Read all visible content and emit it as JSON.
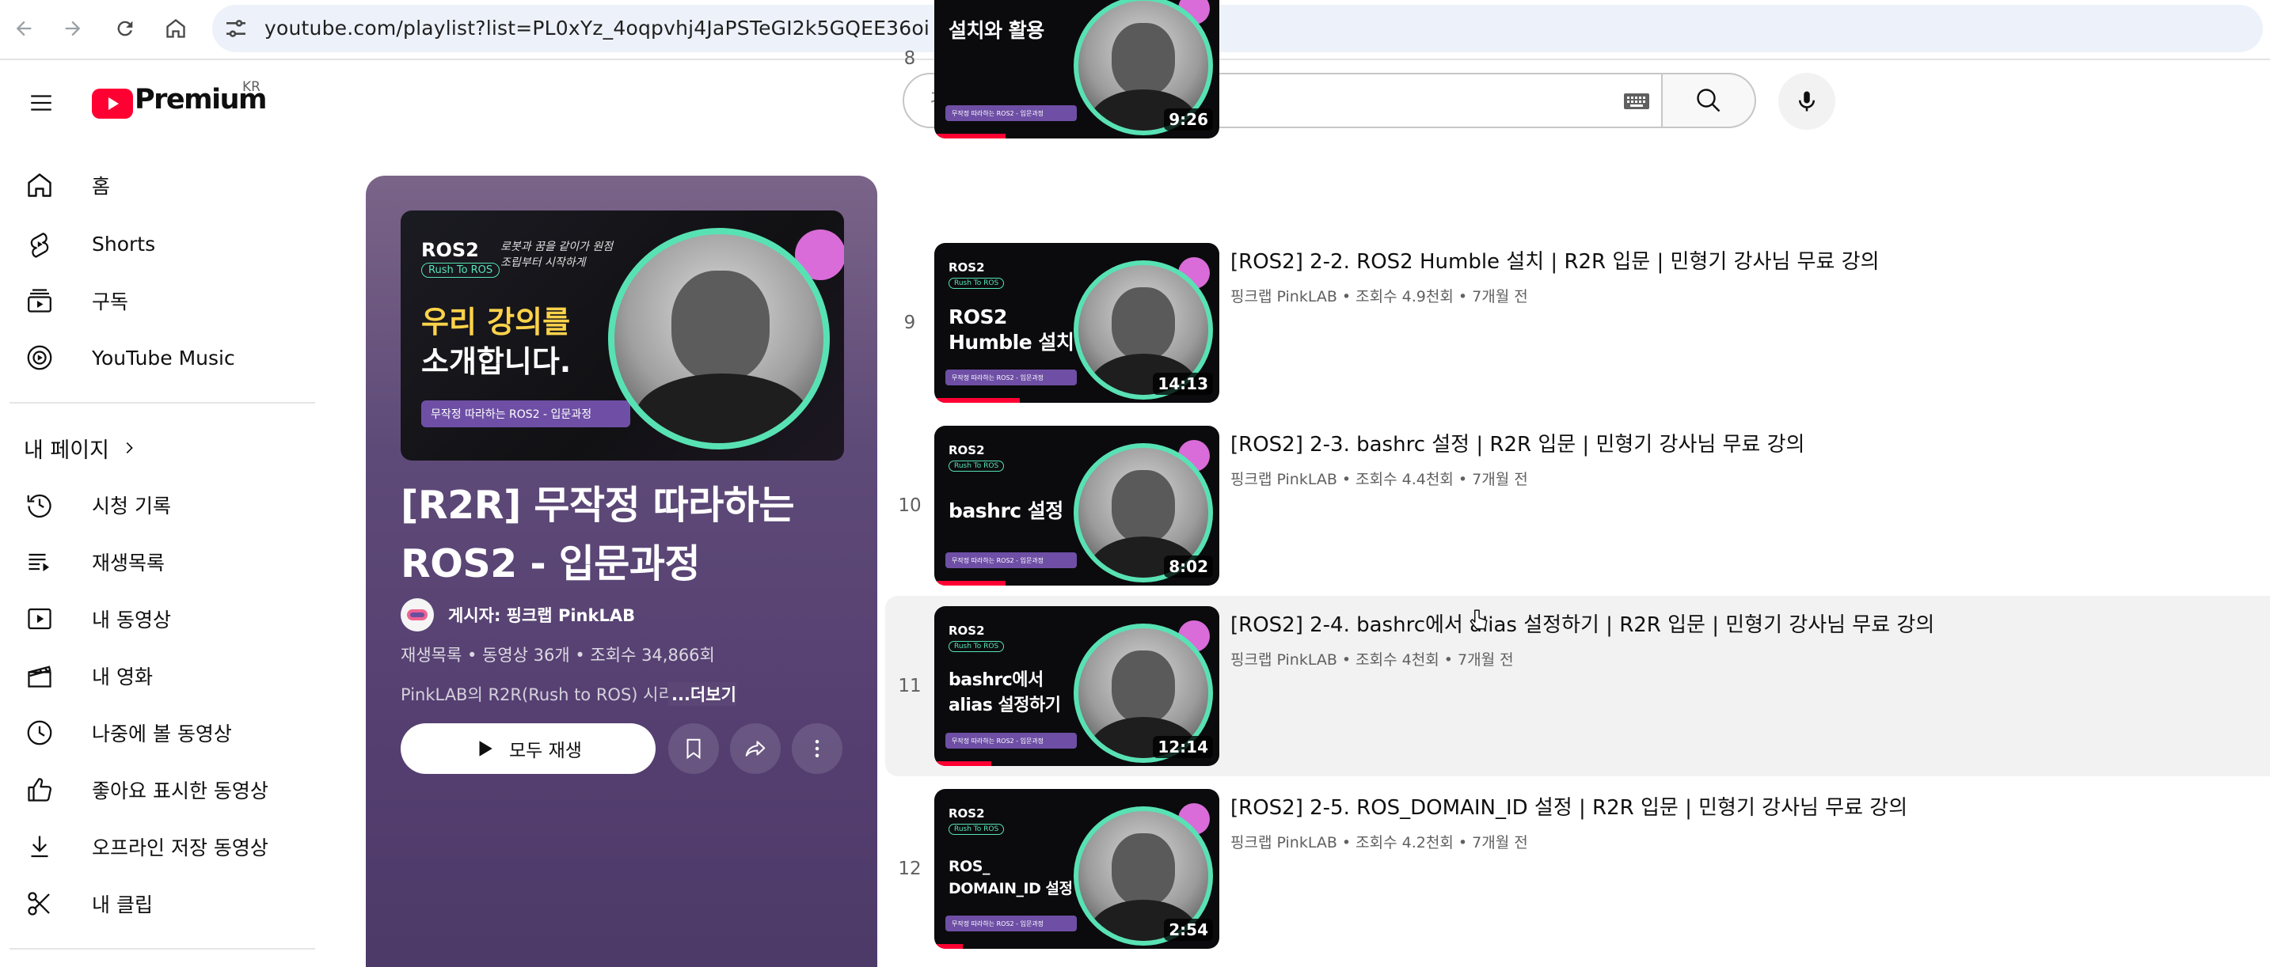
{
  "browser": {
    "url": "youtube.com/playlist?list=PL0xYz_4oqpvhj4JaPSTeGI2k5GQEE36oi"
  },
  "header": {
    "logo_text": "Premium",
    "region": "KR",
    "search_placeholder": "검색"
  },
  "sidebar": {
    "main": [
      {
        "label": "홈",
        "icon": "home-icon"
      },
      {
        "label": "Shorts",
        "icon": "shorts-icon"
      },
      {
        "label": "구독",
        "icon": "subscriptions-icon"
      },
      {
        "label": "YouTube Music",
        "icon": "youtube-music-icon"
      }
    ],
    "section_title": "내 페이지",
    "you": [
      {
        "label": "시청 기록",
        "icon": "history-icon"
      },
      {
        "label": "재생목록",
        "icon": "playlists-icon"
      },
      {
        "label": "내 동영상",
        "icon": "your-videos-icon"
      },
      {
        "label": "내 영화",
        "icon": "your-movies-icon"
      },
      {
        "label": "나중에 볼 동영상",
        "icon": "watch-later-icon"
      },
      {
        "label": "좋아요 표시한 동영상",
        "icon": "liked-videos-icon"
      },
      {
        "label": "오프라인 저장 동영상",
        "icon": "downloads-icon"
      },
      {
        "label": "내 클립",
        "icon": "clips-icon"
      }
    ]
  },
  "playlist": {
    "cover": {
      "brand": "ROS2",
      "badge": "Rush To ROS",
      "handwriting": "로봇과 꿈을 같이가 원점\n조립부터 시작하게",
      "headline_1_accent": "우리 강의를",
      "headline_2": "소개합니다.",
      "strip": "무작정 따라하는 ROS2 - 입문과정"
    },
    "title": "[R2R] 무작정 따라하는 ROS2 - 입문과정",
    "owner": "게시자: 핑크랩 PinkLAB",
    "meta": "재생목록 • 동영상 36개 • 조회수 34,866회",
    "description": "PinkLAB의 R2R(Rush to ROS) 시리",
    "more": "...더보기",
    "play_all": "모두 재생"
  },
  "videos": [
    {
      "index": "",
      "duration": "9:26",
      "thumb_text": "설치와 활용",
      "title": "",
      "meta": "",
      "progress": 0.25
    },
    {
      "index": "9",
      "duration": "14:13",
      "thumb_text": "ROS2\nHumble 설치",
      "title": "[ROS2] 2-2. ROS2 Humble 설치 | R2R 입문 | 민형기 강사님 무료 강의",
      "meta": "핑크랩 PinkLAB • 조회수 4.9천회 • 7개월 전",
      "progress": 0.3
    },
    {
      "index": "10",
      "duration": "8:02",
      "thumb_text": "bashrc 설정",
      "title": "[ROS2] 2-3. bashrc 설정 | R2R 입문 | 민형기 강사님 무료 강의",
      "meta": "핑크랩 PinkLAB • 조회수 4.4천회 • 7개월 전",
      "progress": 0.25
    },
    {
      "index": "11",
      "duration": "12:14",
      "thumb_text": "bashrc에서\nalias 설정하기",
      "title": "[ROS2] 2-4. bashrc에서 alias 설정하기 | R2R 입문 | 민형기 강사님 무료 강의",
      "meta": "핑크랩 PinkLAB • 조회수 4천회 • 7개월 전",
      "progress": 0.2
    },
    {
      "index": "12",
      "duration": "2:54",
      "thumb_text": "ROS_\nDOMAIN_ID 설정",
      "title": "[ROS2] 2-5. ROS_DOMAIN_ID 설정 | R2R 입문 | 민형기 강사님 무료 강의",
      "meta": "핑크랩 PinkLAB • 조회수 4.2천회 • 7개월 전",
      "progress": 0.1
    }
  ],
  "thumb_strip": "무작정 따라하는 ROS2 - 입문과정",
  "colors": {
    "accent": "#ff0033",
    "ring": "#58e2b4",
    "panel": "#5e4a78"
  }
}
